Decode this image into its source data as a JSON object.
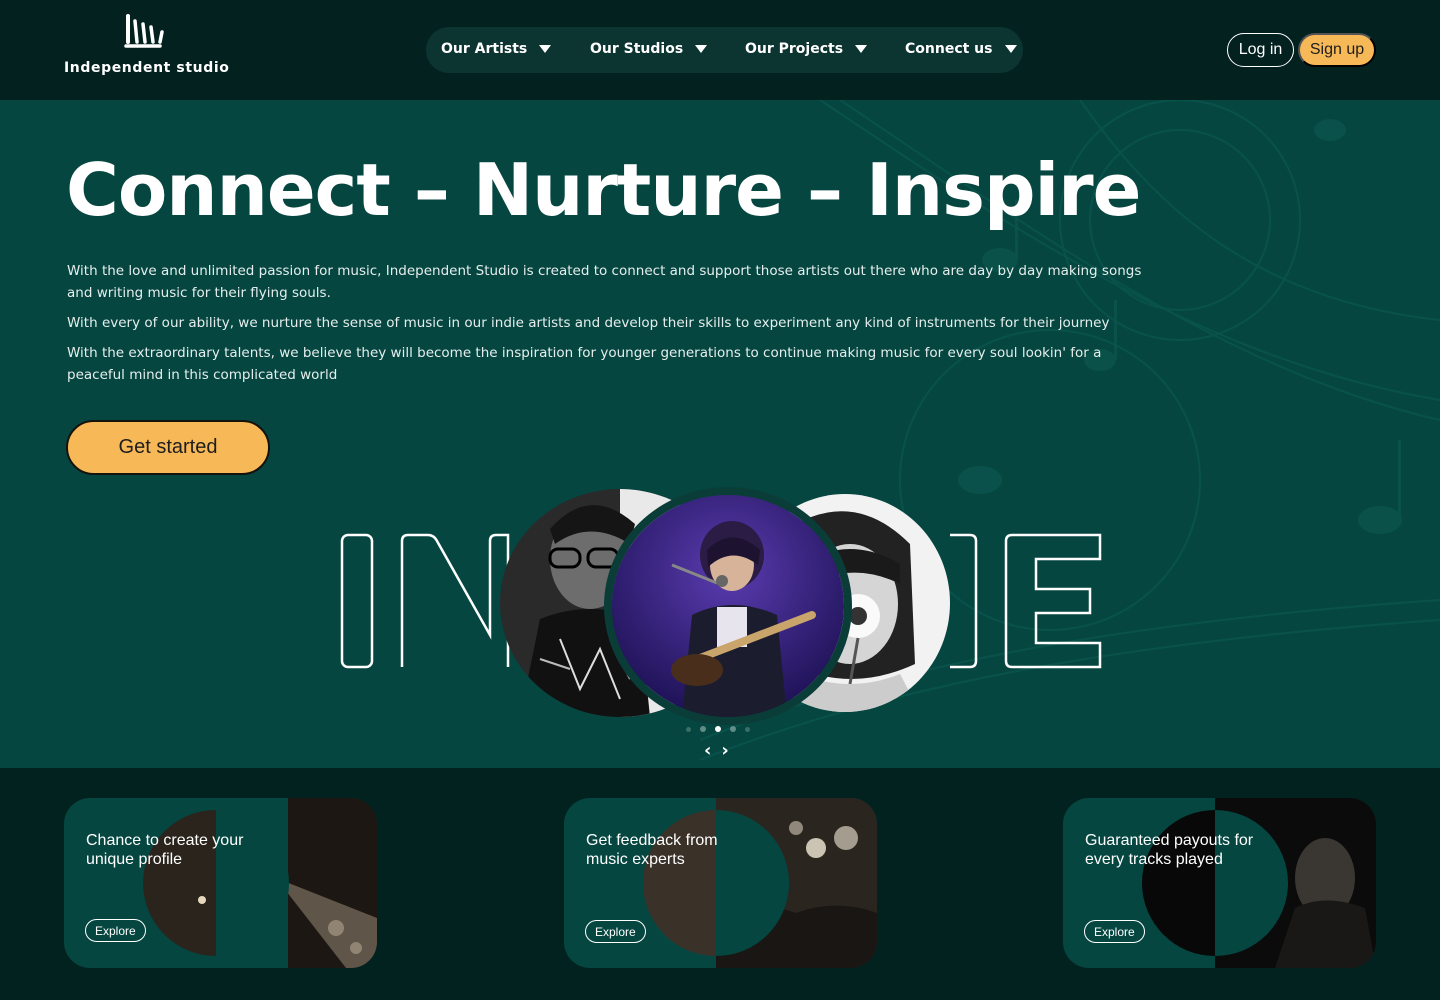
{
  "brand": {
    "name": "Independent studio"
  },
  "nav": [
    {
      "label": "Our Artists"
    },
    {
      "label": "Our Studios"
    },
    {
      "label": "Our Projects"
    },
    {
      "label": "Connect us"
    }
  ],
  "auth": {
    "login": "Log in",
    "signup": "Sign up"
  },
  "hero": {
    "title": "Connect – Nurture – Inspire",
    "paragraphs": [
      "With the love and unlimited passion for music, Independent Studio is created to connect and support those artists out there who are day by day making songs and writing music for their flying souls.",
      "With every of our ability, we nurture the sense of music in our indie artists and develop their skills to experiment any kind of instruments for their journey",
      "With the extraordinary talents, we believe they will become the inspiration for younger generations to continue making music for every soul lookin' for a peaceful mind in this complicated world"
    ],
    "cta": "Get started",
    "slider": {
      "active_index": 2,
      "total": 5
    }
  },
  "cards": [
    {
      "title": "Chance to create your unique profile",
      "button": "Explore"
    },
    {
      "title": "Get feedback from music experts",
      "button": "Explore"
    },
    {
      "title": "Guaranteed payouts for every tracks played",
      "button": "Explore"
    }
  ],
  "colors": {
    "header_bg": "#03211f",
    "hero_bg": "#054640",
    "accent": "#f7b858",
    "page_bg": "#02221f"
  }
}
